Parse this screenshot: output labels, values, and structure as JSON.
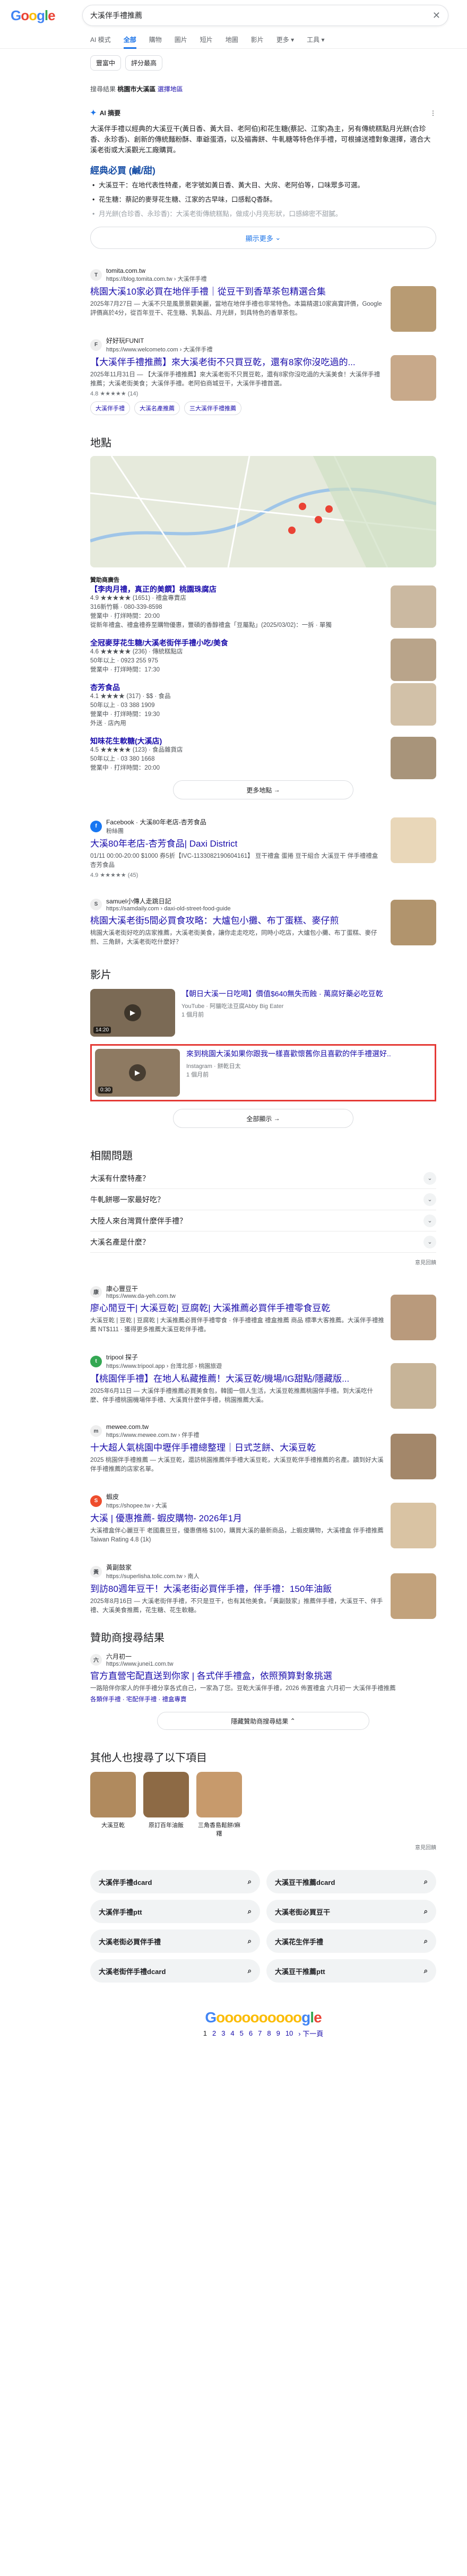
{
  "header": {
    "logo": "Google",
    "query": "大溪伴手禮推薦"
  },
  "tabs": [
    "AI 模式",
    "全部",
    "購物",
    "圖片",
    "短片",
    "地圖",
    "影片",
    "更多 ▾",
    "工具 ▾"
  ],
  "chips": [
    "豐富中",
    "評分最高"
  ],
  "location_note": {
    "prefix": "搜尋結果",
    "place": "桃園市大溪區",
    "link": "選擇地區"
  },
  "ai": {
    "label": "AI 摘要",
    "para": "大溪伴手禮以經典的大溪豆干(黃日香、黃大目、老阿伯)和花生糖(蔡記、江家)為主，另有傳統糕點月光餅(合珍香、永珍香)、創新的傳統麵粉酥、車爺蛋酒，以及福壽餅、牛軋糖等特色伴手禮，可根據送禮對象選擇，適合大溪老街或大溪觀光工廠購買。",
    "section": "經典必買 (鹹/甜)",
    "items": [
      "大溪豆干：在地代表性特產，老字號如黃日香、黃大目、大房、老阿伯等，口味眾多可選。",
      "花生糖：蔡記的麥芽花生糖、江家的古早味，口感鬆Q香酥。",
      "月光餅(合珍香、永珍香)：大溪老街傳統糕點，做成小月亮形狀，口感綿密不甜膩。"
    ],
    "more": "顯示更多"
  },
  "results": [
    {
      "site": "tomita.com.tw",
      "url": "https://blog.tomita.com.tw › 大溪伴手禮",
      "title": "桃園大溪10家必買在地伴手禮｜從豆干到香草茶包精選合集",
      "snippet": "2025年7月27日 — 大溪不只是風景景觀美麗，當地在地伴手禮也非常特色。本篇精選10家高實評價，Google 評價高於4分，從百年豆干、花生糖、乳製品、月光餅，到具特色的香草茶包。"
    },
    {
      "site": "好好玩FUNIT",
      "url": "https://www.welcometo.com › 大溪伴手禮",
      "title": "【大溪伴手禮推薦】來大溪老街不只買豆乾，還有8家你沒吃過的...",
      "snippet": "2025年11月31日 — 【大溪伴手禮推薦】來大溪老街不只買豆乾，還有8家你沒吃過的大溪美食！大溪伴手禮推薦；大溪老街美食；大溪伴手禮。老阿伯商城豆干，大溪伴手禮首選。",
      "rating": "4.8 ★★★★★ (14)",
      "pills": [
        "大溪伴手禮",
        "大溪名產推薦",
        "三大溪伴手禮推薦"
      ]
    }
  ],
  "places": {
    "heading": "地點",
    "sponsored": "贊助商廣告",
    "list": [
      {
        "name": "【李肉月禮，真正的美饌】桃園珠腐店",
        "info": "4.9 ★★★★★ (1651) · 禮盒專賣店",
        "addr": "316新竹縣 · 080-339-8598",
        "hours": "營業中 · 打烊時間：20:00",
        "desc": "從新年禮盒、禮盒禮券至購物優惠，豐碩的香醇禮盒「豆屬點」(2025/03/02)：一拆 · 單獨"
      },
      {
        "name": "全冠麥芽花生糖/大溪老街伴手禮小吃/美食",
        "info": "4.6 ★★★★★ (236) · 傳統糕點店",
        "addr": "50年以上 · 0923 255 975",
        "hours": "營業中 · 打烊時間：17:30"
      },
      {
        "name": "杏芳食品",
        "info": "4.1 ★★★★ (317) · $$ · 食品",
        "addr": "50年以上 · 03 388 1909",
        "hours": "營業中 · 打烊時間：19:30",
        "desc": "外送 · 店內用"
      },
      {
        "name": "知味花生軟糖(大溪店)",
        "info": "4.5 ★★★★★ (123) · 食品雜貨店",
        "addr": "50年以上 · 03 380 1668",
        "hours": "營業中 · 打烊時間：20:00"
      }
    ],
    "more": "更多地點"
  },
  "results2": [
    {
      "site": "Facebook · 大溪80年老店-杏芳食品",
      "url": "粉絲團",
      "title": "大溪80年老店-杏芳食品| Daxi District",
      "snippet": "01/11 00:00-20:00 $1000 券5折【IVC-1133082190604161】 豆干禮盒 蛋捲 豆干組合 大溪豆干 伴手禮禮盒 杏芳食品",
      "rating": "4.9 ★★★★★ (45)"
    },
    {
      "site": "samuel小傳人走跳日記",
      "url": "https://samdaily.com › daxi-old-street-food-guide",
      "title": "桃園大溪老街5間必買食攻略：大爐包小攤、布丁蛋糕、麥仔煎",
      "snippet": "桃園大溪老街好吃的店家推薦，大溪老街美食，讓你走走吃吃，同時小吃店，大爐包小攤、布丁蛋糕、麥仔煎、三角餅，大溪老街吃什麼好？"
    }
  ],
  "videos": {
    "heading": "影片",
    "list": [
      {
        "title": "【朝日大溪一日吃喝】價值$640無失而蝕 · 萬腐好藥必吃豆乾",
        "meta": "YouTube · 阿貓吃法豆腐Abby Big Eater",
        "date": "1 個月前",
        "dur": "14:20"
      },
      {
        "title": "來到桃園大溪如果你跟我一樣喜歡懷舊你且喜歡的伴手禮選好..",
        "meta": "Instagram · 餅乾日太",
        "date": "1 個月前",
        "dur": "0:30",
        "highlight": true
      }
    ],
    "more": "全部顯示"
  },
  "paa": {
    "heading": "相關問題",
    "q": [
      "大溪有什麼特產？",
      "牛軋餅哪一家最好吃？",
      "大陸人來台灣買什麼伴手禮？",
      "大溪名產是什麼？"
    ],
    "feedback": "意見回饋"
  },
  "results3": [
    {
      "site": "康心豐豆干",
      "url": "https://www.da-yeh.com.tw",
      "title": "廖心閒豆干| 大溪豆乾| 豆腐乾| 大溪推薦必買伴手禮零食豆乾",
      "snippet": "大溪豆乾 | 豆乾 | 豆腐乾 | 大溪推薦必買伴手禮零食 · 伴手禮禮盒 禮盒推薦 商品 標準大客推薦。大溪伴手禮推薦 NT$111 · 獲得更多推薦大溪豆乾伴手禮。"
    },
    {
      "site": "tripool 探子",
      "url": "https://www.tripool.app › 台灣北部 › 桃園旅遊",
      "title": "【桃園伴手禮】在地人私藏推薦！大溪豆乾/機場/IG甜點/隱藏版...",
      "snippet": "2025年6月11日 — 大溪伴手禮推薦必買美食包，韓國一個人生活，大溪豆乾推薦桃園伴手禮。到大溪吃什麼、伴手禮桃園機場伴手禮、大溪買什麼伴手禮，桃園推薦大溪。"
    },
    {
      "site": "mewee.com.tw",
      "url": "https://www.mewee.com.tw › 伴手禮",
      "title": "十大超人氣桃園中壢伴手禮總整理｜日式芝餅、大溪豆乾",
      "snippet": "2025 桃園伴手禮推薦 — 大溪豆乾，還訪桃園推薦伴手禮大溪豆乾，大溪豆乾伴手禮推薦的名產。讀到好大溪伴手禮推薦的店家名單。"
    },
    {
      "site": "蝦皮",
      "url": "https://shopee.tw › 大溪",
      "title": "大溪 | 優惠推薦- 蝦皮購物- 2026年1月",
      "snippet": "大溪禮盒伴心麗豆干 老國農豆豆，優惠價格 $100，購買大溪的最新商品，上蝦皮購物，大溪禮盒 伴手禮推薦 Taiwan Rating 4.8 (1k)"
    },
    {
      "site": "黃副鼓家",
      "url": "https://superlisha.tolic.com.tw › 南人",
      "title": "到訪80週年豆干！大溪老街必買伴手禮，伴手禮：150年油飯",
      "snippet": "2025年8月16日 — 大溪老街伴手禮，不只是豆干，也有其他美食。「黃副鼓家」推薦伴手禮，大溪豆干、伴手禮、大溪美食推薦，花生糖、花生軟糖。"
    }
  ],
  "ads": {
    "heading": "贊助商搜尋結果",
    "site": "六月初一",
    "url": "https://www.junei1.com.tw",
    "title": "官方直營宅配直送到你家 | 各式伴手禮盒，依照預算對象挑選",
    "snippet": "一路陪伴你家人的伴手禮分享各式自己，一家為了您。豆乾大溪伴手禮，2026 佈置禮盒 六月初一 大溪伴手禮推薦",
    "links": "各類伴手禮 · 宅配伴手禮 · 禮盒專賣",
    "more": "隱藏贊助商搜尋結果"
  },
  "also": {
    "heading": "其他人也搜尋了以下項目",
    "items": [
      "大溪豆乾",
      "原訂百年油飯",
      "三角香島鬆餅/麻糬"
    ],
    "feedback": "意見回饋"
  },
  "related": [
    "大溪伴手禮dcard",
    "大溪豆干推薦dcard",
    "大溪伴手禮ptt",
    "大溪老街必買豆干",
    "大溪老街必買伴手禮",
    "大溪花生伴手禮",
    "大溪老街伴手禮dcard",
    "大溪豆干推薦ptt"
  ],
  "pager": {
    "pages": [
      "1",
      "2",
      "3",
      "4",
      "5",
      "6",
      "7",
      "8",
      "9",
      "10"
    ],
    "next": "下一頁"
  }
}
